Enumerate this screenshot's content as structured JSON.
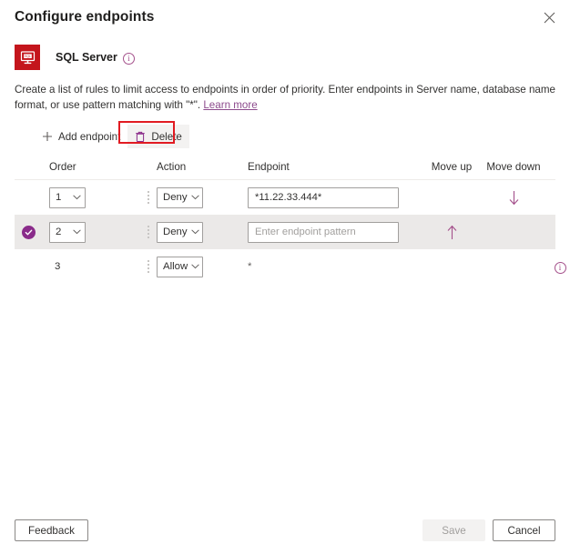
{
  "header": {
    "title": "Configure endpoints",
    "close_icon": "close-icon"
  },
  "service": {
    "icon": "sql-server-icon",
    "name": "SQL Server",
    "info_icon": "info-icon",
    "info_glyph": "i",
    "accent_color": "#c4151c"
  },
  "description": {
    "text_before_link": "Create a list of rules to limit access to endpoints in order of priority. Enter endpoints in Server name, database name format, or use pattern matching with \"*\". ",
    "link_label": "Learn more"
  },
  "toolbar": {
    "add_label": "Add endpoint",
    "add_icon": "plus-icon",
    "delete_label": "Delete",
    "delete_icon": "trash-icon",
    "highlight_color": "#e11b22"
  },
  "table": {
    "columns": {
      "order": "Order",
      "action": "Action",
      "endpoint": "Endpoint",
      "move_up": "Move up",
      "move_down": "Move down"
    },
    "rows": [
      {
        "selected": false,
        "order": "1",
        "order_editable": true,
        "action": "Deny",
        "endpoint_value": "*11.22.33.444*",
        "endpoint_placeholder": "Enter endpoint pattern",
        "endpoint_editable": true,
        "move_up": false,
        "move_down": true,
        "info": false
      },
      {
        "selected": true,
        "order": "2",
        "order_editable": true,
        "action": "Deny",
        "endpoint_value": "",
        "endpoint_placeholder": "Enter endpoint pattern",
        "endpoint_editable": true,
        "move_up": true,
        "move_down": false,
        "info": false
      },
      {
        "selected": false,
        "order": "3",
        "order_editable": false,
        "action": "Allow",
        "endpoint_value": "*",
        "endpoint_placeholder": "",
        "endpoint_editable": false,
        "move_up": false,
        "move_down": false,
        "info": true
      }
    ],
    "action_options": [
      "Allow",
      "Deny"
    ],
    "order_options": [
      "1",
      "2",
      "3"
    ],
    "accent_color": "#8a2b8a"
  },
  "footer": {
    "feedback_label": "Feedback",
    "save_label": "Save",
    "save_disabled": true,
    "cancel_label": "Cancel"
  }
}
